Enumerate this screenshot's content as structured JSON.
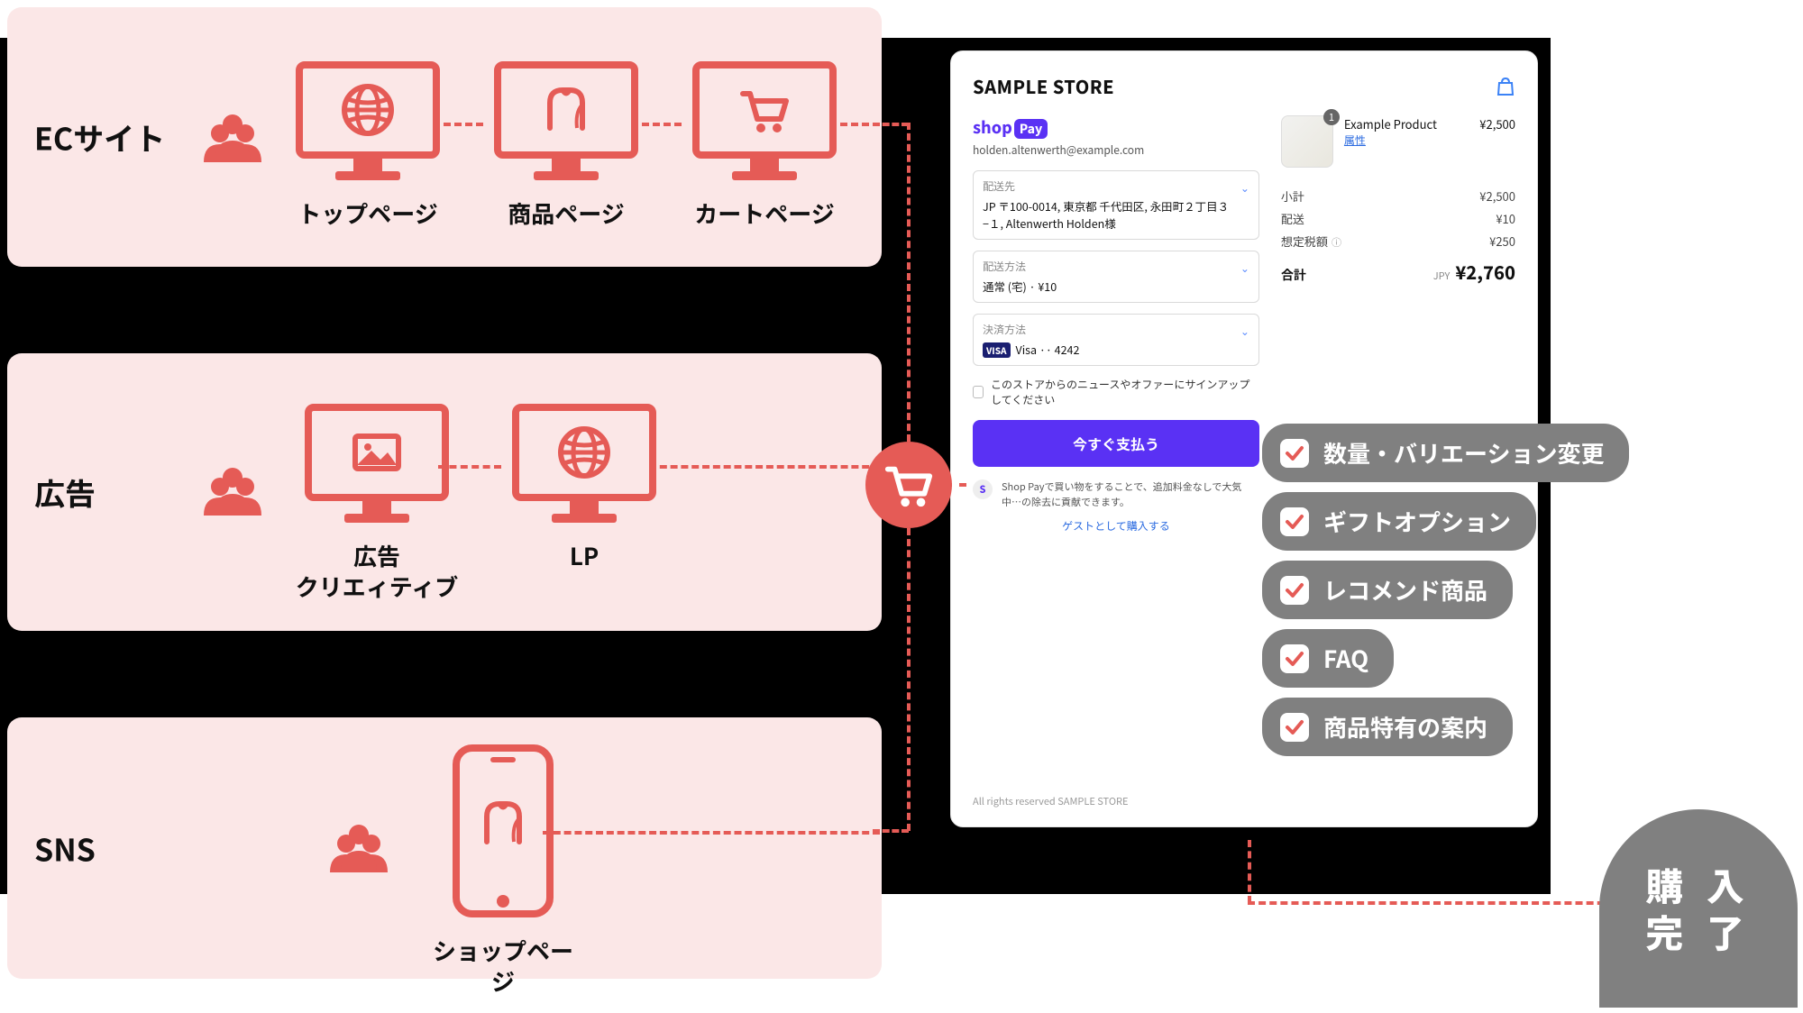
{
  "left": {
    "panel1": {
      "label": "ECサイト",
      "devices": [
        "トップページ",
        "商品ページ",
        "カートページ"
      ]
    },
    "panel2": {
      "label": "広告",
      "devices": [
        "広告\nクリエィティブ",
        "LP"
      ]
    },
    "panel3": {
      "label": "SNS",
      "devices": [
        "ショップページ"
      ]
    }
  },
  "checkout": {
    "store": "SAMPLE STORE",
    "shop": "shop",
    "pay": "Pay",
    "email": "holden.altenwerth@example.com",
    "ship_to_label": "配送先",
    "ship_to_value": "JP 〒100-0014, 東京都 千代田区, 永田町２丁目３−１, Altenwerth Holden様",
    "ship_method_label": "配送方法",
    "ship_method_value": "通常 (宅) · ¥10",
    "pay_method_label": "決済方法",
    "pay_method_value": "Visa ·· 4242",
    "visa_badge": "VISA",
    "newsletter": "このストアからのニュースやオファーにサインアップしてください",
    "paynow": "今すぐ支払う",
    "shoppay_note": "Shop Payで買い物をすることで、追加料金なしで大気中…の除去に貢献できます。",
    "guest": "ゲストとして購入する",
    "product": {
      "name": "Example Product",
      "attr": "属性",
      "qty": "1",
      "price": "¥2,500"
    },
    "summary": {
      "subtotal_label": "小計",
      "subtotal": "¥2,500",
      "ship_label": "配送",
      "ship": "¥10",
      "tax_label": "想定税額",
      "tax": "¥250",
      "total_label": "合計",
      "jpy": "JPY",
      "total": "¥2,760"
    },
    "rights": "All rights reserved SAMPLE STORE"
  },
  "pills": [
    "数量・バリエーション変更",
    "ギフトオプション",
    "レコメンド商品",
    "FAQ",
    "商品特有の案内"
  ],
  "done": "購 入\n完 了"
}
